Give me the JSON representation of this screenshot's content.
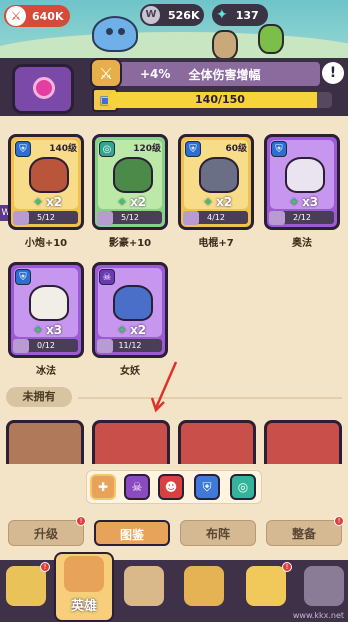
{
  "top_bar": {
    "power": "640K",
    "coins": "526K",
    "gems": "137"
  },
  "buff": {
    "percent": "+4%",
    "text": "全体伤害增幅",
    "info": "!"
  },
  "collection": {
    "progress_text": "140/150",
    "progress_fraction": 0.9333
  },
  "owned_heroes": [
    {
      "name": "小炮+10",
      "level": "140级",
      "count": "x2",
      "progress": "5/12",
      "rarity": "gold",
      "type_icon": "shield-icon",
      "color": "#b8553a"
    },
    {
      "name": "影豪+10",
      "level": "120级",
      "count": "x2",
      "progress": "5/12",
      "rarity": "teal",
      "type_icon": "swirl-icon",
      "color": "#4c8a4a"
    },
    {
      "name": "电棍+7",
      "level": "60级",
      "count": "x2",
      "progress": "4/12",
      "rarity": "gold",
      "type_icon": "shield-icon",
      "color": "#6b6f86"
    },
    {
      "name": "奥法",
      "level": "",
      "count": "x3",
      "progress": "2/12",
      "rarity": "purple",
      "type_icon": "shield-icon",
      "color": "#e9e4f0"
    },
    {
      "name": "冰法",
      "level": "",
      "count": "x3",
      "progress": "0/12",
      "rarity": "purple",
      "type_icon": "shield-icon",
      "color": "#f0eee7"
    },
    {
      "name": "女妖",
      "level": "",
      "count": "x2",
      "progress": "11/12",
      "rarity": "purple",
      "type_icon": "skull-icon",
      "color": "#4a6fc8"
    }
  ],
  "section": {
    "not_owned": "未拥有"
  },
  "filters": [
    {
      "icon": "all-icon",
      "color": "#e8a35a"
    },
    {
      "icon": "skull-icon",
      "color": "#8a4ac0"
    },
    {
      "icon": "mask-icon",
      "color": "#d94040"
    },
    {
      "icon": "shield-icon",
      "color": "#3f7ad8"
    },
    {
      "icon": "swirl-icon",
      "color": "#33b39a"
    }
  ],
  "tabs": {
    "upgrade": "升级",
    "codex": "图鉴",
    "formation": "布阵",
    "equip": "整备"
  },
  "nav": {
    "heroes": "英雄"
  },
  "watermark": "www.kkx.net"
}
